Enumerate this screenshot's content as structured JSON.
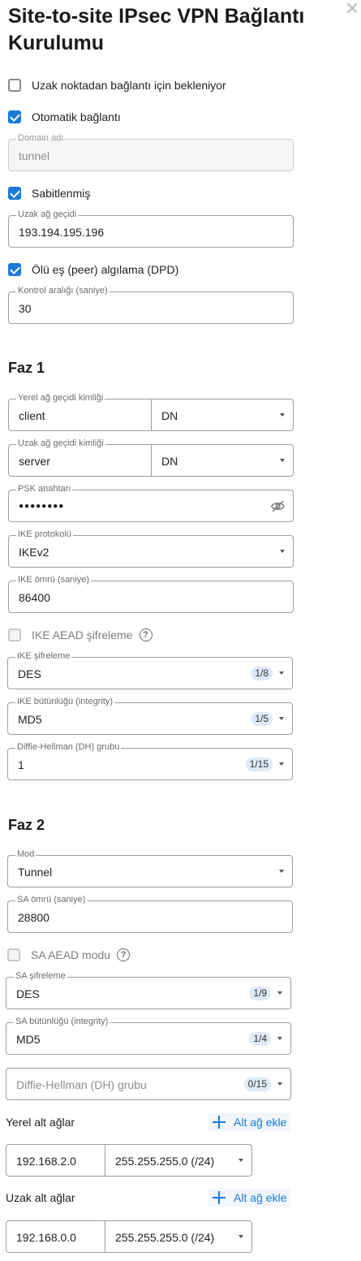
{
  "title": "Site-to-site IPsec VPN Bağlantı Kurulumu",
  "options": {
    "wait_remote": "Uzak noktadan bağlantı için bekleniyor",
    "auto_connect": "Otomatik bağlantı",
    "pinned": "Sabitlenmiş",
    "dpd": "Ölü eş (peer) algılama (DPD)"
  },
  "fields": {
    "domain_label": "Domain adı",
    "domain_value": "tunnel",
    "remote_gw_label": "Uzak ağ geçidi",
    "remote_gw_value": "193.194.195.196",
    "interval_label": "Kontrol aralığı (saniye)",
    "interval_value": "30"
  },
  "phase1": {
    "heading": "Faz 1",
    "local_id_label": "Yerel ağ geçidi kimliği",
    "local_id_value": "client",
    "local_id_type": "DN",
    "remote_id_label": "Uzak ağ geçidi kimliği",
    "remote_id_value": "server",
    "remote_id_type": "DN",
    "psk_label": "PSK anahtarı",
    "psk_masked": "●●●●●●●●",
    "ike_proto_label": "IKE protokolü",
    "ike_proto_value": "IKEv2",
    "ike_life_label": "IKE ömrü (saniye)",
    "ike_life_value": "86400",
    "aead_label": "IKE AEAD şifreleme",
    "enc_label": "IKE şifreleme",
    "enc_value": "DES",
    "enc_badge": "1/8",
    "integ_label": "IKE bütünlüğü (integrity)",
    "integ_value": "MD5",
    "integ_badge": "1/5",
    "dh_label": "Diffie-Hellman (DH) grubu",
    "dh_value": "1",
    "dh_badge": "1/15"
  },
  "phase2": {
    "heading": "Faz 2",
    "mode_label": "Mod",
    "mode_value": "Tunnel",
    "sa_life_label": "SA ömrü (saniye)",
    "sa_life_value": "28800",
    "aead_label": "SA AEAD modu",
    "enc_label": "SA şifreleme",
    "enc_value": "DES",
    "enc_badge": "1/9",
    "integ_label": "SA bütünlüğü (integrity)",
    "integ_value": "MD5",
    "integ_badge": "1/4",
    "dh_placeholder": "Diffie-Hellman (DH) grubu",
    "dh_badge": "0/15"
  },
  "local_subnets": {
    "label": "Yerel alt ağlar",
    "add_label": "Alt ağ ekle",
    "ip": "192.168.2.0",
    "mask": "255.255.255.0 (/24)"
  },
  "remote_subnets": {
    "label": "Uzak alt ağlar",
    "add_label": "Alt ağ ekle",
    "ip": "192.168.0.0",
    "mask": "255.255.255.0 (/24)"
  }
}
